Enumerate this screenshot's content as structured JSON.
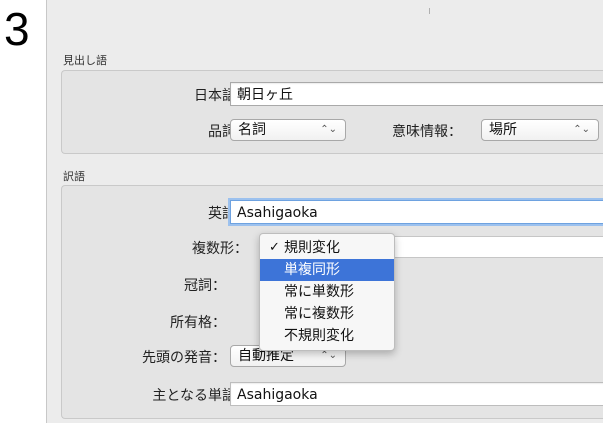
{
  "step_number": "3",
  "headword_section": {
    "title": "見出し語",
    "japanese_label": "日本語：",
    "japanese_value": "朝日ヶ丘",
    "pos_label": "品詞：",
    "pos_value": "名詞",
    "semantic_label": "意味情報：",
    "semantic_value": "場所"
  },
  "translation_section": {
    "title": "訳語",
    "english_label": "英語：",
    "english_value": "Asahigaoka",
    "plural_label": "複数形：",
    "article_label": "冠詞：",
    "possessive_label": "所有格：",
    "pronunciation_label": "先頭の発音：",
    "pronunciation_value": "自動推定",
    "mainword_label": "主となる単語：",
    "mainword_value": "Asahigaoka"
  },
  "plural_menu": {
    "items": [
      {
        "label": "規則変化",
        "checked": true
      },
      {
        "label": "単複同形",
        "highlighted": true
      },
      {
        "label": "常に単数形"
      },
      {
        "label": "常に複数形"
      },
      {
        "label": "不規則変化"
      }
    ],
    "check_glyph": "✓",
    "highlight_color": "#3d74d8"
  },
  "popup_arrows": "⌃⌄"
}
